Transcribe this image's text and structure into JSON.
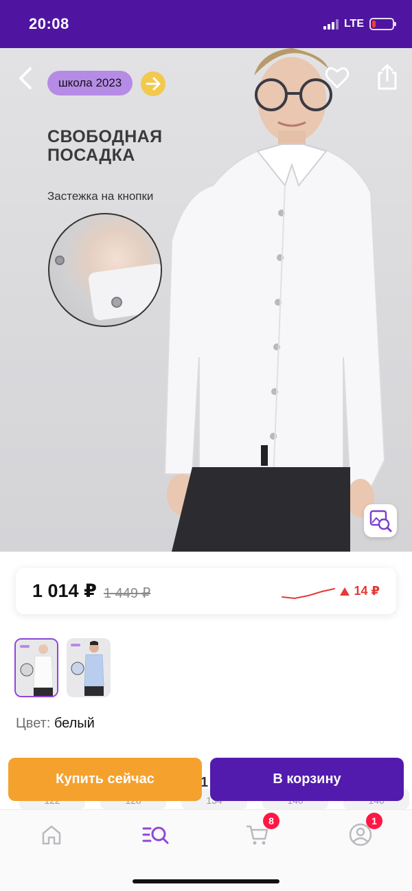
{
  "status_bar": {
    "time": "20:08",
    "network": "LTE"
  },
  "hero": {
    "tag_label": "школа 2023",
    "headline_line1": "СВОБОДНАЯ",
    "headline_line2": "ПОСАДКА",
    "subline": "Застежка на кнопки"
  },
  "price": {
    "current": "1 014 ₽",
    "old": "1 449 ₽",
    "delta": "14 ₽",
    "trend": "up"
  },
  "variants": {
    "count": 2,
    "selected": 0
  },
  "color": {
    "label": "Цвет:",
    "value": "белый"
  },
  "sizes": [
    "122",
    "128",
    "134",
    "140",
    "146"
  ],
  "actions": {
    "buy_now": "Купить сейчас",
    "add_to_cart": "В корзину",
    "peek_text": "1"
  },
  "nav": {
    "items": [
      "home",
      "catalog-search",
      "cart",
      "profile"
    ],
    "cart_badge": "8",
    "profile_badge": "1"
  },
  "colors": {
    "brand": "#521bad",
    "accent_orange": "#f5a12e",
    "price_up": "#e53935",
    "badge": "#ff1744"
  }
}
